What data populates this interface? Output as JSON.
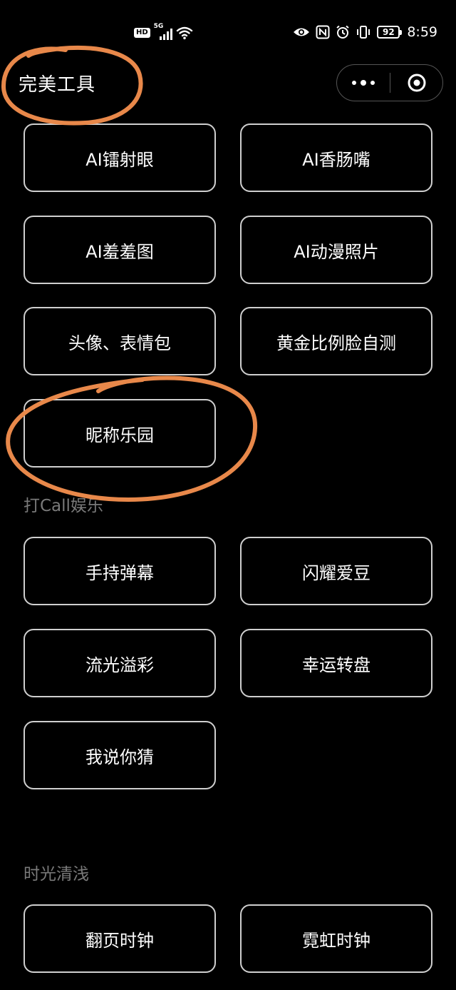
{
  "status_bar": {
    "network_badge": "HD",
    "network_type": "5G",
    "battery": "92",
    "time": "8:59",
    "icons": [
      "hd-icon",
      "signal-icon",
      "wifi-icon",
      "eye-icon",
      "nfc-icon",
      "alarm-icon",
      "vibrate-icon",
      "battery-icon"
    ]
  },
  "header": {
    "title": "完美工具",
    "capsule": {
      "more_icon": "more-dots-icon",
      "close_icon": "target-circle-icon"
    }
  },
  "section1": {
    "buttons": [
      "AI镭射眼",
      "AI香肠嘴",
      "AI羞羞图",
      "AI动漫照片",
      "头像、表情包",
      "黄金比例脸自测",
      "昵称乐园"
    ]
  },
  "section2": {
    "title": "打Call娱乐",
    "buttons": [
      "手持弹幕",
      "闪耀爱豆",
      "流光溢彩",
      "幸运转盘",
      "我说你猜"
    ]
  },
  "section3": {
    "title": "时光清浅",
    "buttons": [
      "翻页时钟",
      "霓虹时钟"
    ]
  },
  "colors": {
    "background": "#000000",
    "button_border": "#cfcfcf",
    "section_title": "#7a7a7a",
    "annotation": "#e8884a"
  }
}
